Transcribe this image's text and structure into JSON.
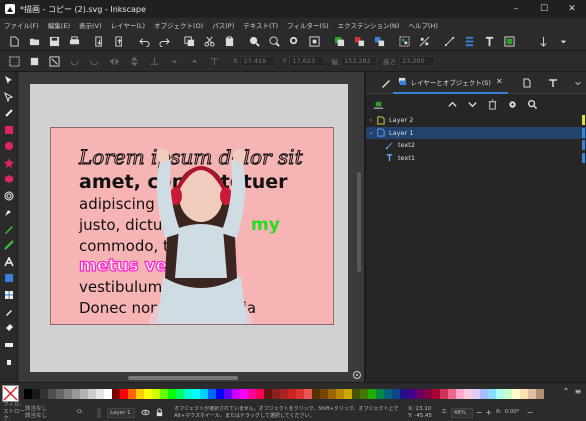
{
  "window": {
    "title": "*描画 - コピー (2).svg - Inkscape",
    "minimize": "–",
    "maximize": "☐",
    "close": "✕"
  },
  "menu": [
    "ファイル(F)",
    "編集(E)",
    "表示(V)",
    "レイヤー(L)",
    "オブジェクト(O)",
    "パス(P)",
    "テキスト(T)",
    "フィルター(S)",
    "エクステンション(N)",
    "ヘルプ(H)"
  ],
  "tool_controls": {
    "x_label": "X",
    "x": "27.419",
    "y_label": "Y",
    "y": "17.623",
    "w_label": "幅",
    "w": "153.282",
    "h_label": "高さ",
    "h": "23.290"
  },
  "artwork": {
    "lines": [
      "Lorem ipsum dolor sit",
      "amet, consectetuer",
      "adipiscing elit",
      "justo, dictum my",
      "commodo, tempor",
      "metus vehicula",
      "vestibulum luctus.",
      "Donec non dolor lacinia"
    ],
    "highlight_green": "#22dd22",
    "highlight_magenta": "#ff22cc",
    "background": "#f7b4b4"
  },
  "panel": {
    "active_tab": "レイヤーとオブジェクト(S)",
    "layers": [
      {
        "name": "Layer 2",
        "indicator": "#dede33"
      },
      {
        "name": "Layer 1",
        "indicator": "#3a82d8",
        "selected": true
      },
      {
        "name": "text2",
        "indicator": "#3a82d8"
      },
      {
        "name": "text1",
        "indicator": "#3a82d8"
      }
    ]
  },
  "status": {
    "fill_label": "フィル:",
    "stroke_label": "ストローク:",
    "fill_value": "該当なし",
    "stroke_value": "該当なし",
    "opacity_label": "O:",
    "layer": "Layer 1",
    "message": "オブジェクトが選択されていません。オブジェクトをクリック、Shift+クリック、オブジェクト上でAlt+マウスホイール、またはドラッグして選択してください。",
    "x_label": "X:",
    "y_label": "Y:",
    "x": "23.10",
    "y": "-45.45",
    "zoom_label": "Z:",
    "zoom": "48%",
    "rotation_label": "R:",
    "rotation": "0.00°"
  },
  "palette_colors": [
    "#000000",
    "#1a1a1a",
    "#333333",
    "#4d4d4d",
    "#666666",
    "#808080",
    "#999999",
    "#b3b3b3",
    "#cccccc",
    "#e6e6e6",
    "#ffffff",
    "#800000",
    "#ff0000",
    "#ff6600",
    "#ffcc00",
    "#ffff00",
    "#ccff00",
    "#66ff00",
    "#00ff00",
    "#00ff66",
    "#00ffcc",
    "#00ffff",
    "#00ccff",
    "#0066ff",
    "#0000ff",
    "#6600ff",
    "#cc00ff",
    "#ff00ff",
    "#ff0099",
    "#ff0055",
    "#661111",
    "#882222",
    "#aa2222",
    "#cc2222",
    "#dd3333",
    "#ee5555",
    "#553300",
    "#774400",
    "#996600",
    "#bb8800",
    "#ccaa00",
    "#445500",
    "#447700",
    "#22aa00",
    "#008844",
    "#006677",
    "#114488",
    "#221188",
    "#440088",
    "#660066",
    "#880044",
    "#aa0033",
    "#cc3355",
    "#ee6688",
    "#ffaacc",
    "#ffccdd",
    "#ddccff",
    "#aabbff",
    "#88ddff",
    "#aaffee",
    "#ccffcc",
    "#ffffcc",
    "#ffe0b0",
    "#ddc0a0",
    "#b09070"
  ],
  "icons": [
    "new-icon",
    "open-icon",
    "save-icon",
    "print-icon",
    "import-icon",
    "export-icon",
    "undo-icon",
    "redo-icon",
    "copy-icon",
    "cut-icon",
    "paste-icon",
    "zoom-selection-icon",
    "zoom-drawing-icon",
    "zoom-page-icon",
    "zoom-fit-icon",
    "duplicate-icon",
    "clone-icon",
    "unlink-clone-icon",
    "group-icon",
    "ungroup-icon",
    "node-editor-icon",
    "xml-editor-icon",
    "text-font-icon",
    "align-icon",
    "fill-stroke-icon",
    "document-properties-icon",
    "preferences-icon",
    "more-icon"
  ]
}
